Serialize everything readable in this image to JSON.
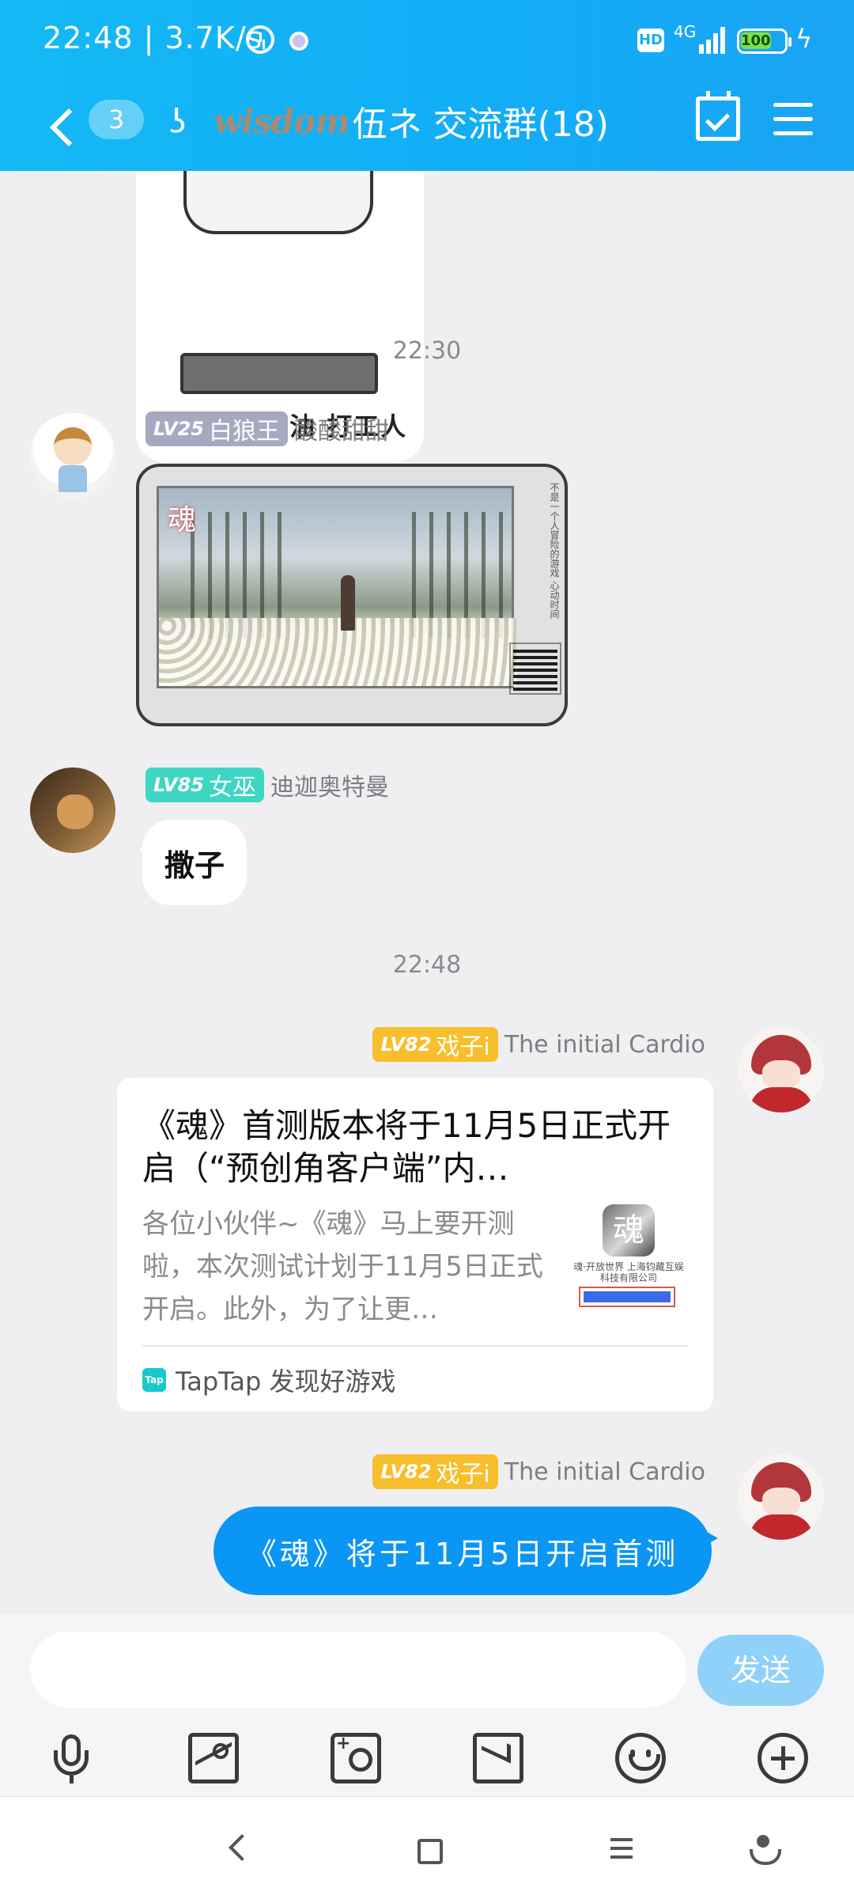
{
  "status_bar": {
    "time": "22:48 | 3.7K/s",
    "hd_label": "HD",
    "network": "4G",
    "battery": "100"
  },
  "navbar": {
    "unread_count": "3",
    "group_logo_text": "wisdom",
    "group_name": "伍ネ 交流群(18)"
  },
  "chat": {
    "sticker_caption": "加油 打工人",
    "timestamps": [
      "22:30",
      "22:48"
    ],
    "messages": [
      {
        "sender_level": "LV25",
        "sender_title": "白狼王",
        "sender_name": "酸酸甜甜",
        "type": "image",
        "image_logo": "魂",
        "image_poem": "不是一个人冒险的游戏 心动时间"
      },
      {
        "sender_level": "LV85",
        "sender_title": "女巫",
        "sender_name": "迪迦奥特曼",
        "type": "text",
        "text": "撒子"
      },
      {
        "sender_level": "LV82",
        "sender_title": "戏子i",
        "sender_name": "The initial Cardio",
        "type": "link_card",
        "card_title": "《魂》首测版本将于11月5日正式开启（“预创角客户端”内…",
        "card_desc": "各位小伙伴~《魂》马上要开测啦，本次测试计划于11月5日正式开启。此外，为了让更…",
        "card_thumb_logo": "魂",
        "card_thumb_text": "魂·开放世界 上海钧藏互娱科技有限公司",
        "card_source": "TapTap 发现好游戏",
        "card_source_icon": "Tap"
      },
      {
        "sender_level": "LV82",
        "sender_title": "戏子i",
        "sender_name": "The initial Cardio",
        "type": "text",
        "text": "《魂》将于11月5日开启首测"
      }
    ]
  },
  "input": {
    "placeholder": "",
    "send_label": "发送"
  },
  "colors": {
    "header": "#14b9f5",
    "outgoing_bubble": "#0a96f5",
    "send_button": "#8fd1f8",
    "level_grey": "#a7a9c1",
    "level_teal": "#3dd6c4",
    "level_gold": "#f8bf2c"
  }
}
